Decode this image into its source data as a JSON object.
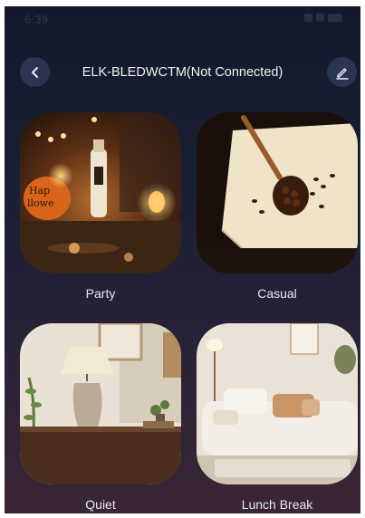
{
  "status_bar": {
    "time": "6:39"
  },
  "header": {
    "back_icon": "chevron-left-icon",
    "title": "ELK-BLEDWCTM(Not Connected)",
    "edit_icon": "pencil-icon"
  },
  "scenes": [
    {
      "label": "Party"
    },
    {
      "label": "Casual"
    },
    {
      "label": "Quiet"
    },
    {
      "label": "Lunch Break"
    }
  ]
}
